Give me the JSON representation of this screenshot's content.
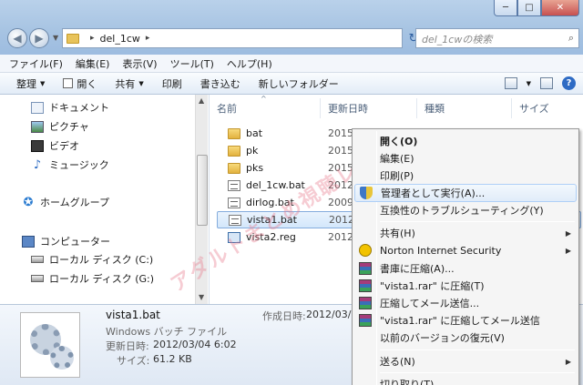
{
  "window": {
    "controls": {
      "minimize": "─",
      "maximize": "□",
      "close": "✕"
    }
  },
  "nav": {
    "back_glyph": "◀",
    "forward_glyph": "▶",
    "dropdown_glyph": "▼"
  },
  "address": {
    "separator": "▸",
    "path": "del_1cw",
    "trailing": "▸",
    "refresh_glyph": "↻"
  },
  "search": {
    "placeholder": "del_1cwの検索",
    "icon_glyph": "⌕"
  },
  "menubar": {
    "items": [
      "ファイル(F)",
      "編集(E)",
      "表示(V)",
      "ツール(T)",
      "ヘルプ(H)"
    ]
  },
  "commandbar": {
    "organize": "整理",
    "open": "開く",
    "share": "共有",
    "print": "印刷",
    "burn": "書き込む",
    "new_folder": "新しいフォルダー",
    "dropdown_glyph": "▼",
    "help_glyph": "?"
  },
  "navpane": {
    "items": [
      {
        "label": "ドキュメント",
        "icon": "document-icon"
      },
      {
        "label": "ピクチャ",
        "icon": "picture-icon"
      },
      {
        "label": "ビデオ",
        "icon": "video-icon"
      },
      {
        "label": "ミュージック",
        "icon": "music-icon"
      },
      {
        "label": "ホームグループ",
        "icon": "homegroup-icon"
      },
      {
        "label": "コンピューター",
        "icon": "computer-icon"
      },
      {
        "label": "ローカル ディスク (C:)",
        "icon": "disk-icon"
      },
      {
        "label": "ローカル ディスク (G:)",
        "icon": "disk-icon"
      }
    ],
    "glyphs": {
      "music": "♪",
      "home": "✪",
      "scroll_up": "▲",
      "scroll_down": "▼"
    }
  },
  "filelist": {
    "columns": {
      "name": "名前",
      "date": "更新日時",
      "type": "種類",
      "size": "サイズ"
    },
    "sort_glyph": "^",
    "files": [
      {
        "name": "bat",
        "date": "2015",
        "kind": "folder"
      },
      {
        "name": "pk",
        "date": "2015",
        "kind": "folder"
      },
      {
        "name": "pks",
        "date": "2015",
        "kind": "folder"
      },
      {
        "name": "del_1cw.bat",
        "date": "2012",
        "kind": "bat"
      },
      {
        "name": "dirlog.bat",
        "date": "2009",
        "kind": "bat"
      },
      {
        "name": "vista1.bat",
        "date": "2012",
        "kind": "bat",
        "selected": true
      },
      {
        "name": "vista2.reg",
        "date": "2012",
        "kind": "reg"
      }
    ]
  },
  "watermark": "アダルトまとめ視聴レビュー",
  "details": {
    "filename": "vista1.bat",
    "filetype": "Windows バッチ ファイル",
    "modified_label": "更新日時:",
    "modified_value": "2012/03/04 6:02",
    "size_label": "サイズ:",
    "size_value": "61.2 KB",
    "created_label": "作成日時:",
    "created_value": "2012/03/0"
  },
  "contextmenu": {
    "items": [
      {
        "label": "開く(O)",
        "bold": true
      },
      {
        "label": "編集(E)"
      },
      {
        "label": "印刷(P)"
      },
      {
        "label": "管理者として実行(A)...",
        "icon": "shield-icon",
        "hover": true
      },
      {
        "label": "互換性のトラブルシューティング(Y)"
      },
      {
        "label": "共有(H)",
        "submenu": true
      },
      {
        "label": "Norton Internet Security",
        "icon": "norton-icon",
        "submenu": true
      },
      {
        "label": "書庫に圧縮(A)...",
        "icon": "winrar-icon"
      },
      {
        "label": "\"vista1.rar\" に圧縮(T)",
        "icon": "winrar-icon"
      },
      {
        "label": "圧縮してメール送信...",
        "icon": "winrar-icon"
      },
      {
        "label": "\"vista1.rar\" に圧縮してメール送信",
        "icon": "winrar-icon"
      },
      {
        "label": "以前のバージョンの復元(V)"
      },
      {
        "label": "送る(N)",
        "submenu": true
      },
      {
        "label": "切り取り(T)"
      }
    ],
    "submenu_glyph": "▶"
  }
}
